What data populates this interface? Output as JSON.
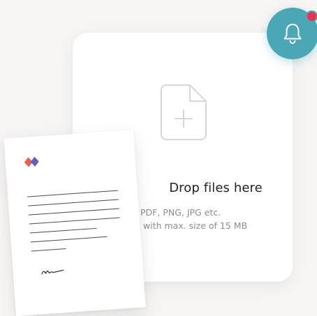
{
  "dropzone": {
    "title": "Drop files here",
    "formats": "PDF, PNG, JPG etc.",
    "size_limit": "with max. size of 15 MB",
    "icon": "file-plus-icon"
  },
  "notification": {
    "icon": "bell-icon",
    "has_unread": true
  },
  "colors": {
    "accent": "#4aa8b6",
    "badge": "#f0304f",
    "logo_red": "#e8604a",
    "logo_purple": "#5a4fc0"
  }
}
